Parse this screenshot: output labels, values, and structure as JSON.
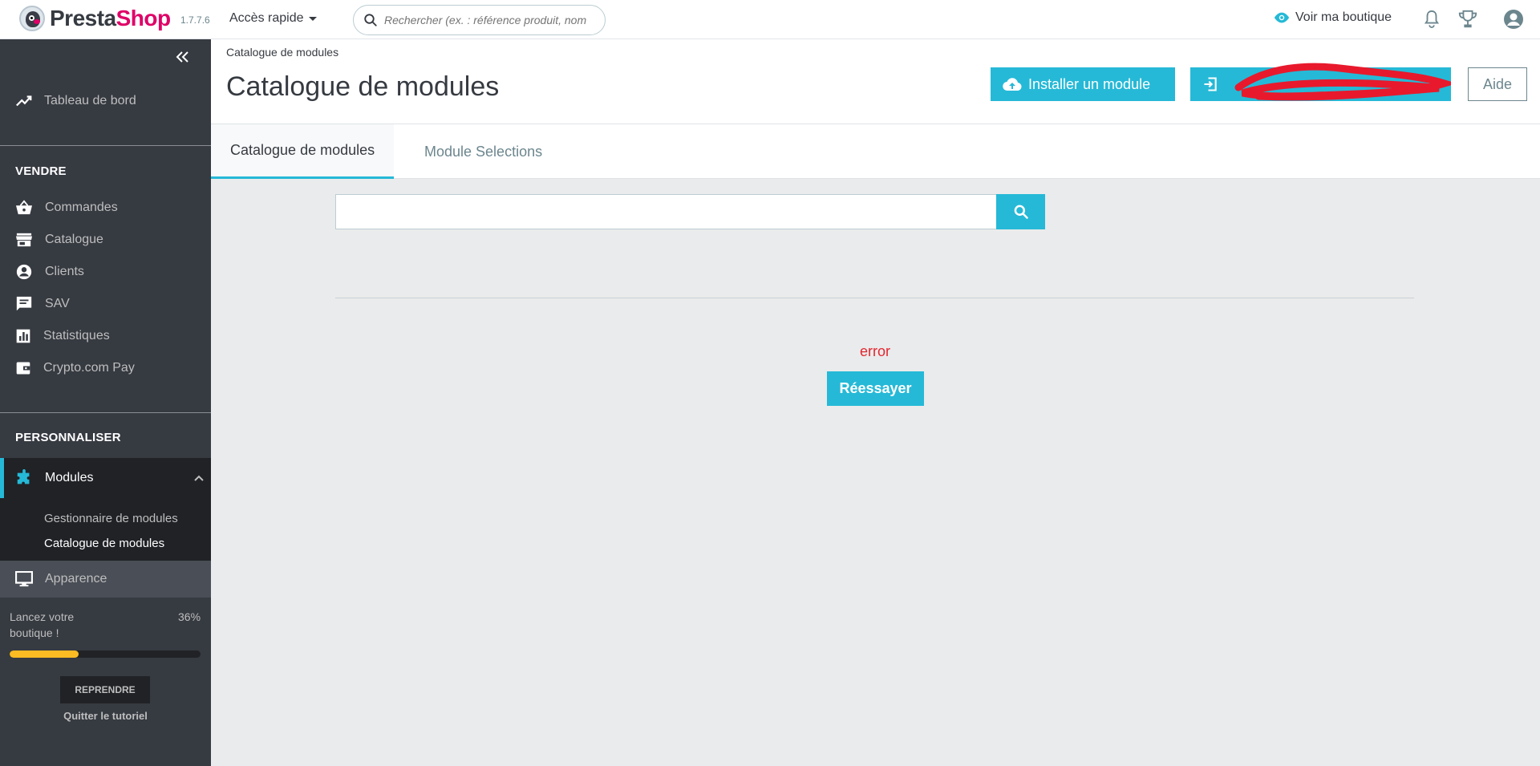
{
  "header": {
    "logo_part1": "Presta",
    "logo_part2": "Shop",
    "version": "1.7.7.6",
    "quick_access": "Accès rapide",
    "search_placeholder": "Rechercher (ex. : référence produit, nom",
    "view_shop": "Voir ma boutique",
    "icons": [
      "prestashop-logo-icon",
      "search-icon",
      "eye-icon",
      "bell-icon",
      "trophy-icon",
      "user-account-icon"
    ]
  },
  "sidebar": {
    "dashboard": "Tableau de bord",
    "section_sell": "VENDRE",
    "sell_items": [
      {
        "label": "Commandes",
        "icon": "basket-icon"
      },
      {
        "label": "Catalogue",
        "icon": "store-icon"
      },
      {
        "label": "Clients",
        "icon": "account-circle-icon"
      },
      {
        "label": "SAV",
        "icon": "chat-icon"
      },
      {
        "label": "Statistiques",
        "icon": "bar-chart-icon"
      },
      {
        "label": "Crypto.com Pay",
        "icon": "wallet-icon"
      }
    ],
    "section_customize": "PERSONNALISER",
    "modules": "Modules",
    "sub_items": [
      "Gestionnaire de modules",
      "Catalogue de modules"
    ],
    "appearance": "Apparence",
    "onboarding": {
      "text": "Lancez votre boutique !",
      "percent_label": "36%",
      "percent": 36,
      "resume": "REPRENDRE",
      "quit": "Quitter le tutoriel"
    }
  },
  "page": {
    "breadcrumb": "Catalogue de modules",
    "title": "Catalogue de modules",
    "install_button": "Installer un module",
    "connect_button": "",
    "help_button": "Aide"
  },
  "tabs": [
    "Catalogue de modules",
    "Module Selections"
  ],
  "content": {
    "search_value": "",
    "error": "error",
    "retry": "Réessayer"
  },
  "colors": {
    "accent": "#25b9d7",
    "sidebar": "#363a41",
    "error": "#e3262f",
    "progress": "#fbbb22",
    "brand": "#df0067"
  }
}
